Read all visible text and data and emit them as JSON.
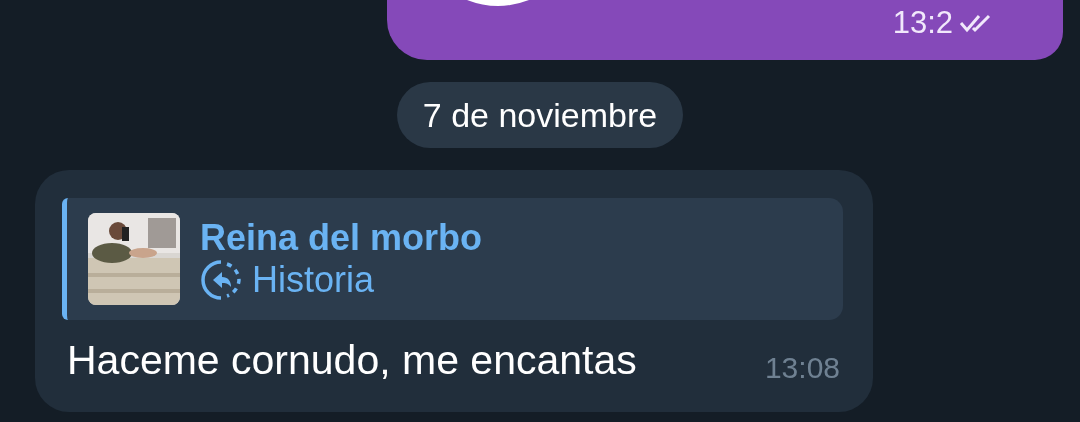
{
  "outgoing_message": {
    "time": "13:2",
    "read": true
  },
  "date_separator": "7 de noviembre",
  "incoming_message": {
    "reply": {
      "author": "Reina del morbo",
      "kind": "story",
      "label": "Historia"
    },
    "text": "Haceme cornudo, me encantas",
    "time": "13:08"
  }
}
